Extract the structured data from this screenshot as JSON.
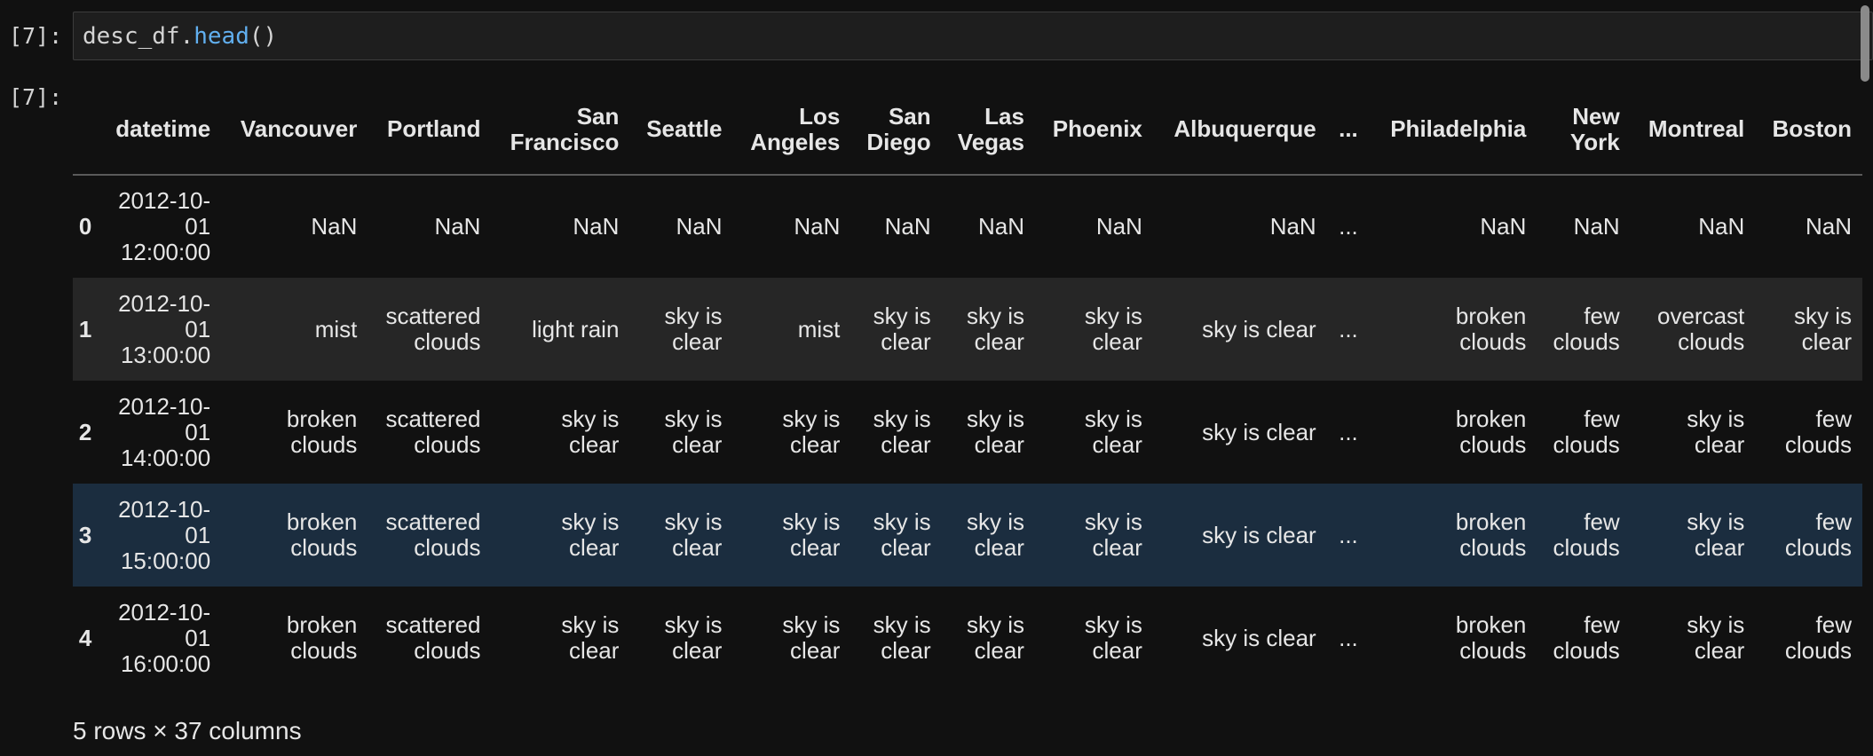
{
  "input_prompt": "[7]:",
  "output_prompt": "[7]:",
  "code": {
    "var": "desc_df.",
    "fn": "head",
    "args": "()"
  },
  "table": {
    "columns": [
      "datetime",
      "Vancouver",
      "Portland",
      "San\nFrancisco",
      "Seattle",
      "Los\nAngeles",
      "San\nDiego",
      "Las\nVegas",
      "Phoenix",
      "Albuquerque",
      "...",
      "Philadelphia",
      "New\nYork",
      "Montreal",
      "Boston"
    ],
    "rows": [
      {
        "index": "0",
        "cells": [
          "2012-10-\n01\n12:00:00",
          "NaN",
          "NaN",
          "NaN",
          "NaN",
          "NaN",
          "NaN",
          "NaN",
          "NaN",
          "NaN",
          "...",
          "NaN",
          "NaN",
          "NaN",
          "NaN"
        ]
      },
      {
        "index": "1",
        "cells": [
          "2012-10-\n01\n13:00:00",
          "mist",
          "scattered\nclouds",
          "light rain",
          "sky is\nclear",
          "mist",
          "sky is\nclear",
          "sky is\nclear",
          "sky is\nclear",
          "sky is clear",
          "...",
          "broken\nclouds",
          "few\nclouds",
          "overcast\nclouds",
          "sky is\nclear"
        ]
      },
      {
        "index": "2",
        "cells": [
          "2012-10-\n01\n14:00:00",
          "broken\nclouds",
          "scattered\nclouds",
          "sky is\nclear",
          "sky is\nclear",
          "sky is\nclear",
          "sky is\nclear",
          "sky is\nclear",
          "sky is\nclear",
          "sky is clear",
          "...",
          "broken\nclouds",
          "few\nclouds",
          "sky is\nclear",
          "few\nclouds"
        ]
      },
      {
        "index": "3",
        "cells": [
          "2012-10-\n01\n15:00:00",
          "broken\nclouds",
          "scattered\nclouds",
          "sky is\nclear",
          "sky is\nclear",
          "sky is\nclear",
          "sky is\nclear",
          "sky is\nclear",
          "sky is\nclear",
          "sky is clear",
          "...",
          "broken\nclouds",
          "few\nclouds",
          "sky is\nclear",
          "few\nclouds"
        ]
      },
      {
        "index": "4",
        "cells": [
          "2012-10-\n01\n16:00:00",
          "broken\nclouds",
          "scattered\nclouds",
          "sky is\nclear",
          "sky is\nclear",
          "sky is\nclear",
          "sky is\nclear",
          "sky is\nclear",
          "sky is\nclear",
          "sky is clear",
          "...",
          "broken\nclouds",
          "few\nclouds",
          "sky is\nclear",
          "few\nclouds"
        ]
      }
    ],
    "hover_row": 3
  },
  "shape_text": "5 rows × 37 columns",
  "colors": {
    "background": "#111111",
    "hover_row": "#1b2d3f",
    "stripe": "#262626",
    "function": "#61afef"
  }
}
